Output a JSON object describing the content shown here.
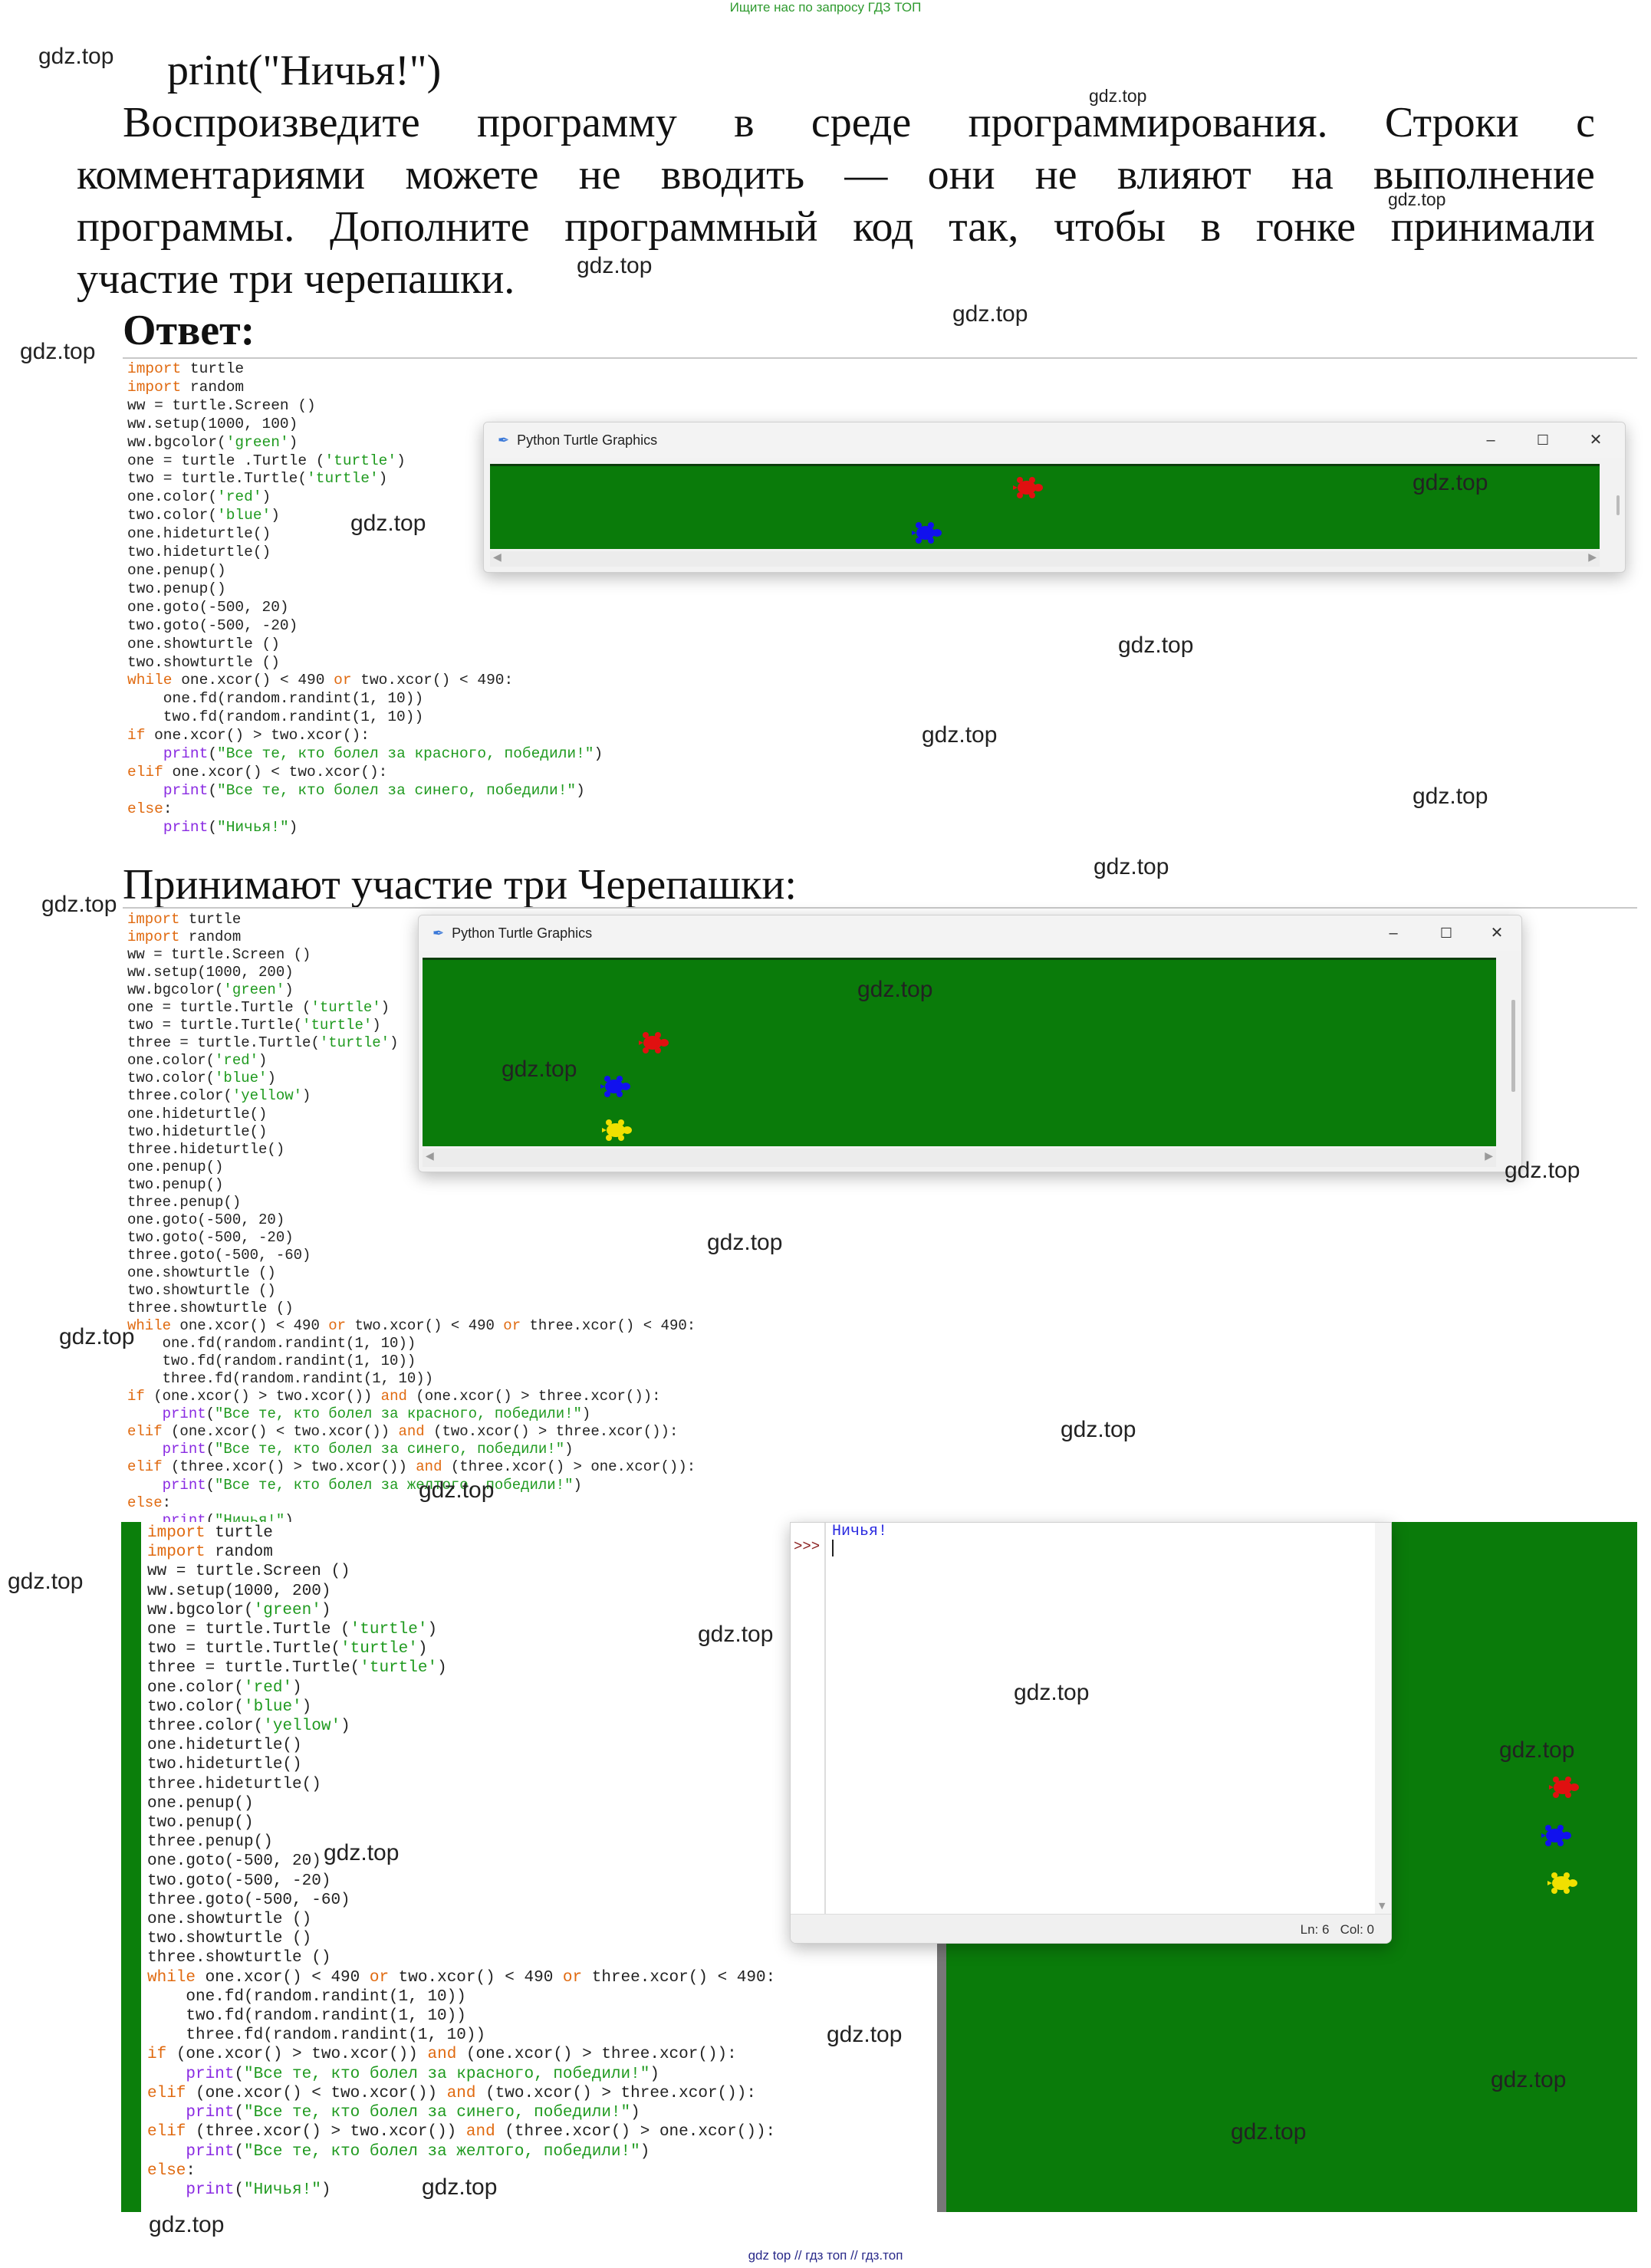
{
  "site_top_link": "Ищите нас по запросу ГДЗ ТОП",
  "site_bottom_link": "gdz top  //  гдз топ  //  гдз.топ",
  "watermark": "gdz.top",
  "intro": {
    "code_line": "print(\"Ничья!\")",
    "lines": [
      [
        "Воспроизведите",
        "программу",
        "в",
        "среде",
        "программирования.",
        "Строки",
        "с"
      ],
      [
        "комментариями",
        "можете",
        "не",
        "вводить",
        "—",
        "они",
        "не",
        "влияют",
        "на",
        "выполнение"
      ],
      [
        "программы.",
        "Дополните",
        "программный",
        "код",
        "так,",
        "чтобы",
        "в",
        "гонке",
        "принимали"
      ]
    ],
    "last_line": "участие три черепашки."
  },
  "answer_heading": "Ответ:",
  "section2_heading": "Принимают участие три Черепашки:",
  "turtle_window": {
    "title": "Python Turtle Graphics",
    "minimize": "–",
    "maximize": "☐",
    "close": "✕"
  },
  "turtle_colors": {
    "red": "#e01010",
    "blue": "#1111ee",
    "yellow": "#f0e000",
    "field": "#0a7b0a"
  },
  "code1": [
    [
      [
        "kw",
        "import"
      ],
      [
        "t",
        " turtle"
      ]
    ],
    [
      [
        "kw",
        "import"
      ],
      [
        "t",
        " random"
      ]
    ],
    [
      [
        "t",
        "ww = turtle.Screen ()"
      ]
    ],
    [
      [
        "t",
        "ww.setup(1000, 100)"
      ]
    ],
    [
      [
        "t",
        "ww.bgcolor("
      ],
      [
        "st",
        "'green'"
      ],
      [
        "t",
        ")"
      ]
    ],
    [
      [
        "t",
        "one = turtle .Turtle ("
      ],
      [
        "st",
        "'turtle'"
      ],
      [
        "t",
        ")"
      ]
    ],
    [
      [
        "t",
        "two = turtle.Turtle("
      ],
      [
        "st",
        "'turtle'"
      ],
      [
        "t",
        ")"
      ]
    ],
    [
      [
        "t",
        "one.color("
      ],
      [
        "st",
        "'red'"
      ],
      [
        "t",
        ")"
      ]
    ],
    [
      [
        "t",
        "two.color("
      ],
      [
        "st",
        "'blue'"
      ],
      [
        "t",
        ")"
      ]
    ],
    [
      [
        "t",
        "one.hideturtle()"
      ]
    ],
    [
      [
        "t",
        "two.hideturtle()"
      ]
    ],
    [
      [
        "t",
        "one.penup()"
      ]
    ],
    [
      [
        "t",
        "two.penup()"
      ]
    ],
    [
      [
        "t",
        "one.goto(-500, 20)"
      ]
    ],
    [
      [
        "t",
        "two.goto(-500, -20)"
      ]
    ],
    [
      [
        "t",
        "one.showturtle ()"
      ]
    ],
    [
      [
        "t",
        "two.showturtle ()"
      ]
    ],
    [
      [
        "kw",
        "while"
      ],
      [
        "t",
        " one.xcor() < 490 "
      ],
      [
        "kw",
        "or"
      ],
      [
        "t",
        " two.xcor() < 490:"
      ]
    ],
    [
      [
        "t",
        "    one.fd(random.randint(1, 10))"
      ]
    ],
    [
      [
        "t",
        "    two.fd(random.randint(1, 10))"
      ]
    ],
    [
      [
        "kw",
        "if"
      ],
      [
        "t",
        " one.xcor() > two.xcor():"
      ]
    ],
    [
      [
        "t",
        "    "
      ],
      [
        "fn",
        "print"
      ],
      [
        "t",
        "("
      ],
      [
        "st",
        "\"Все те, кто болел за красного, победили!\""
      ],
      [
        "t",
        ")"
      ]
    ],
    [
      [
        "kw",
        "elif"
      ],
      [
        "t",
        " one.xcor() < two.xcor():"
      ]
    ],
    [
      [
        "t",
        "    "
      ],
      [
        "fn",
        "print"
      ],
      [
        "t",
        "("
      ],
      [
        "st",
        "\"Все те, кто болел за синего, победили!\""
      ],
      [
        "t",
        ")"
      ]
    ],
    [
      [
        "kw",
        "else"
      ],
      [
        "t",
        ":"
      ]
    ],
    [
      [
        "t",
        "    "
      ],
      [
        "fn",
        "print"
      ],
      [
        "t",
        "("
      ],
      [
        "st",
        "\"Ничья!\""
      ],
      [
        "t",
        ")"
      ]
    ]
  ],
  "code2": [
    [
      [
        "kw",
        "import"
      ],
      [
        "t",
        " turtle"
      ]
    ],
    [
      [
        "kw",
        "import"
      ],
      [
        "t",
        " random"
      ]
    ],
    [
      [
        "t",
        "ww = turtle.Screen ()"
      ]
    ],
    [
      [
        "t",
        "ww.setup(1000, 200)"
      ]
    ],
    [
      [
        "t",
        "ww.bgcolor("
      ],
      [
        "st",
        "'green'"
      ],
      [
        "t",
        ")"
      ]
    ],
    [
      [
        "t",
        "one = turtle.Turtle ("
      ],
      [
        "st",
        "'turtle'"
      ],
      [
        "t",
        ")"
      ]
    ],
    [
      [
        "t",
        "two = turtle.Turtle("
      ],
      [
        "st",
        "'turtle'"
      ],
      [
        "t",
        ")"
      ]
    ],
    [
      [
        "t",
        "three = turtle.Turtle("
      ],
      [
        "st",
        "'turtle'"
      ],
      [
        "t",
        ")"
      ]
    ],
    [
      [
        "t",
        "one.color("
      ],
      [
        "st",
        "'red'"
      ],
      [
        "t",
        ")"
      ]
    ],
    [
      [
        "t",
        "two.color("
      ],
      [
        "st",
        "'blue'"
      ],
      [
        "t",
        ")"
      ]
    ],
    [
      [
        "t",
        "three.color("
      ],
      [
        "st",
        "'yellow'"
      ],
      [
        "t",
        ")"
      ]
    ],
    [
      [
        "t",
        "one.hideturtle()"
      ]
    ],
    [
      [
        "t",
        "two.hideturtle()"
      ]
    ],
    [
      [
        "t",
        "three.hideturtle()"
      ]
    ],
    [
      [
        "t",
        "one.penup()"
      ]
    ],
    [
      [
        "t",
        "two.penup()"
      ]
    ],
    [
      [
        "t",
        "three.penup()"
      ]
    ],
    [
      [
        "t",
        "one.goto(-500, 20)"
      ]
    ],
    [
      [
        "t",
        "two.goto(-500, -20)"
      ]
    ],
    [
      [
        "t",
        "three.goto(-500, -60)"
      ]
    ],
    [
      [
        "t",
        "one.showturtle ()"
      ]
    ],
    [
      [
        "t",
        "two.showturtle ()"
      ]
    ],
    [
      [
        "t",
        "three.showturtle ()"
      ]
    ],
    [
      [
        "kw",
        "while"
      ],
      [
        "t",
        " one.xcor() < 490 "
      ],
      [
        "kw",
        "or"
      ],
      [
        "t",
        " two.xcor() < 490 "
      ],
      [
        "kw",
        "or"
      ],
      [
        "t",
        " three.xcor() < 490:"
      ]
    ],
    [
      [
        "t",
        "    one.fd(random.randint(1, 10))"
      ]
    ],
    [
      [
        "t",
        "    two.fd(random.randint(1, 10))"
      ]
    ],
    [
      [
        "t",
        "    three.fd(random.randint(1, 10))"
      ]
    ],
    [
      [
        "kw",
        "if"
      ],
      [
        "t",
        " (one.xcor() > two.xcor()) "
      ],
      [
        "kw",
        "and"
      ],
      [
        "t",
        " (one.xcor() > three.xcor()):"
      ]
    ],
    [
      [
        "t",
        "    "
      ],
      [
        "fn",
        "print"
      ],
      [
        "t",
        "("
      ],
      [
        "st",
        "\"Все те, кто болел за красного, победили!\""
      ],
      [
        "t",
        ")"
      ]
    ],
    [
      [
        "kw",
        "elif"
      ],
      [
        "t",
        " (one.xcor() < two.xcor()) "
      ],
      [
        "kw",
        "and"
      ],
      [
        "t",
        " (two.xcor() > three.xcor()):"
      ]
    ],
    [
      [
        "t",
        "    "
      ],
      [
        "fn",
        "print"
      ],
      [
        "t",
        "("
      ],
      [
        "st",
        "\"Все те, кто болел за синего, победили!\""
      ],
      [
        "t",
        ")"
      ]
    ],
    [
      [
        "kw",
        "elif"
      ],
      [
        "t",
        " (three.xcor() > two.xcor()) "
      ],
      [
        "kw",
        "and"
      ],
      [
        "t",
        " (three.xcor() > one.xcor()):"
      ]
    ],
    [
      [
        "t",
        "    "
      ],
      [
        "fn",
        "print"
      ],
      [
        "t",
        "("
      ],
      [
        "st",
        "\"Все те, кто болел за желтого, победили!\""
      ],
      [
        "t",
        ")"
      ]
    ],
    [
      [
        "kw",
        "else"
      ],
      [
        "t",
        ":"
      ]
    ],
    [
      [
        "t",
        "    "
      ],
      [
        "fn",
        "print"
      ],
      [
        "t",
        "("
      ],
      [
        "st",
        "\"Ничья!\""
      ],
      [
        "t",
        ")"
      ]
    ]
  ],
  "shell": {
    "output": "Ничья!",
    "prompt": ">>>",
    "status": "Ln: 6   Col: 0"
  }
}
